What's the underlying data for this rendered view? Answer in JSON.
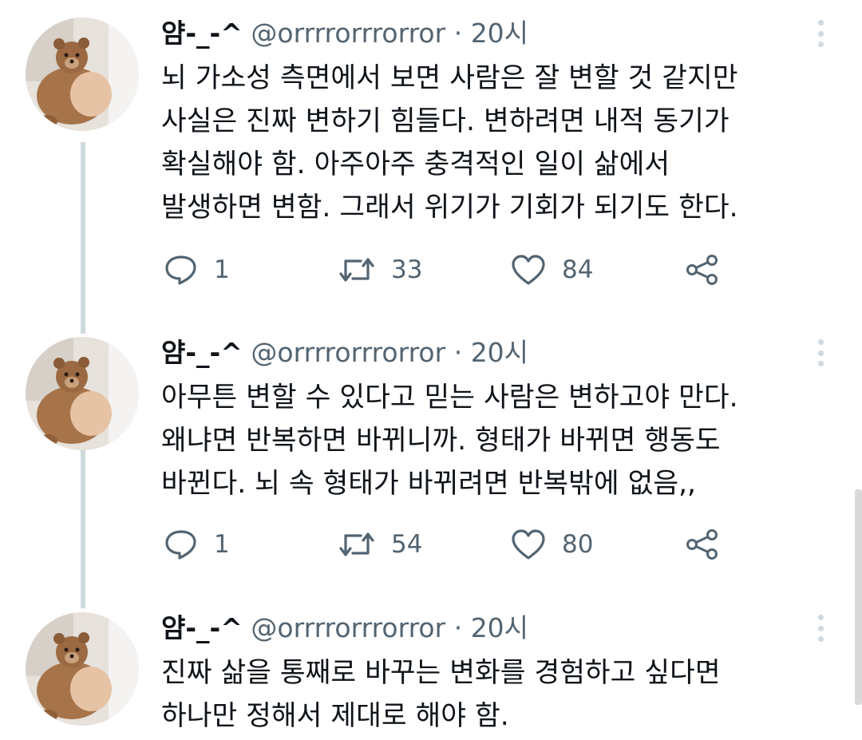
{
  "tweets": [
    {
      "name": "얌-_-^",
      "handle": "@orrrrorrrorror",
      "separator": "·",
      "time": "20시",
      "lines": [
        "뇌 가소성 측면에서 보면 사람은 잘 변할 것 같지만",
        "사실은 진짜 변하기 힘들다. 변하려면 내적 동기가",
        "확실해야 함. 아주아주 충격적인 일이 삶에서",
        "발생하면 변함. 그래서 위기가 기회가 되기도 한다."
      ],
      "replies": "1",
      "retweets": "33",
      "likes": "84"
    },
    {
      "name": "얌-_-^",
      "handle": "@orrrrorrrorror",
      "separator": "·",
      "time": "20시",
      "lines": [
        "아무튼 변할 수 있다고 믿는 사람은 변하고야 만다.",
        "왜냐면 반복하면 바뀌니까. 형태가 바뀌면 행동도",
        "바뀐다. 뇌 속 형태가 바뀌려면 반복밖에 없음,,"
      ],
      "replies": "1",
      "retweets": "54",
      "likes": "80"
    },
    {
      "name": "얌-_-^",
      "handle": "@orrrrorrrorror",
      "separator": "·",
      "time": "20시",
      "lines": [
        "진짜 삶을 통째로 바꾸는 변화를 경험하고 싶다면",
        "하나만 정해서 제대로 해야 함."
      ]
    }
  ],
  "icons": {
    "reply": "reply-icon",
    "retweet": "retweet-icon",
    "like": "heart-icon",
    "share": "share-icon",
    "more": "more-vertical-icon"
  },
  "colors": {
    "text": "#0f1419",
    "secondary": "#536471",
    "thread_line": "#cfd9de"
  }
}
